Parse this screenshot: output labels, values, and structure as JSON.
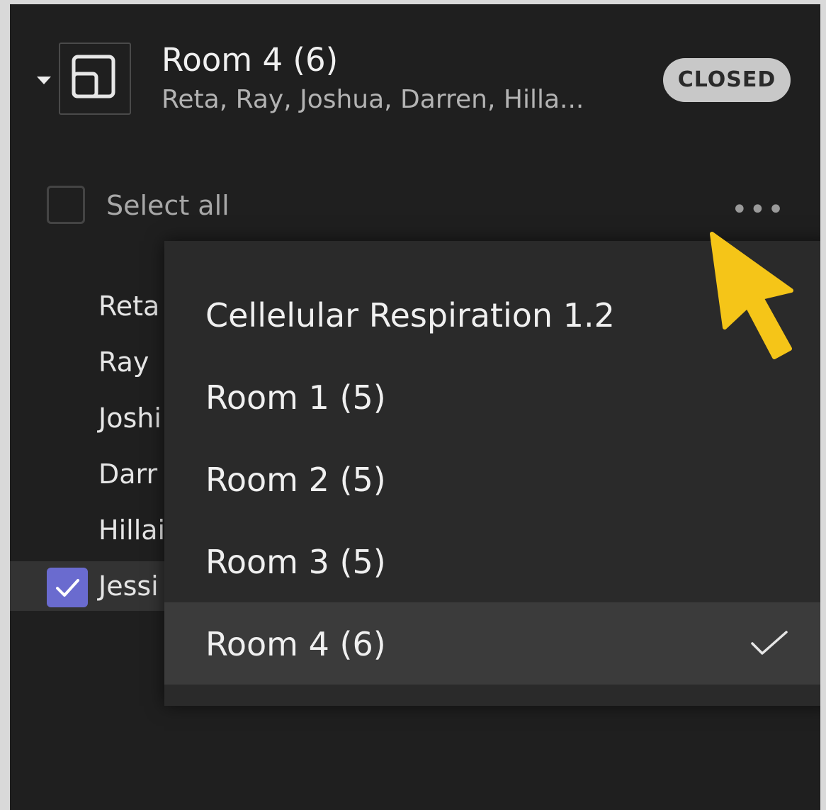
{
  "room": {
    "title": "Room 4 (6)",
    "members_preview": "Reta, Ray, Joshua, Darren, Hilla...",
    "status_badge": "CLOSED"
  },
  "select_all": {
    "label": "Select all",
    "checked": false
  },
  "more_icon": "ellipsis-icon",
  "participants": [
    {
      "name_visible": "Reta",
      "checked": false
    },
    {
      "name_visible": "Ray ",
      "checked": false
    },
    {
      "name_visible": "Joshi",
      "checked": false
    },
    {
      "name_visible": "Darr",
      "checked": false
    },
    {
      "name_visible": "Hillai",
      "checked": false
    },
    {
      "name_visible": "Jessi",
      "checked": true
    }
  ],
  "move_to_menu": {
    "items": [
      {
        "label": "Cellelular Respiration 1.2",
        "selected": false
      },
      {
        "label": "Room 1 (5)",
        "selected": false
      },
      {
        "label": "Room 2 (5)",
        "selected": false
      },
      {
        "label": "Room 3 (5)",
        "selected": false
      },
      {
        "label": "Room 4 (6)",
        "selected": true
      }
    ]
  },
  "colors": {
    "panel_bg": "#1f1f1f",
    "menu_bg": "#2a2a2a",
    "selected_item_bg": "#3b3b3b",
    "checkbox_accent": "#6a6bcf",
    "cursor": "#f5c518",
    "badge_bg": "#c8c8c8"
  }
}
